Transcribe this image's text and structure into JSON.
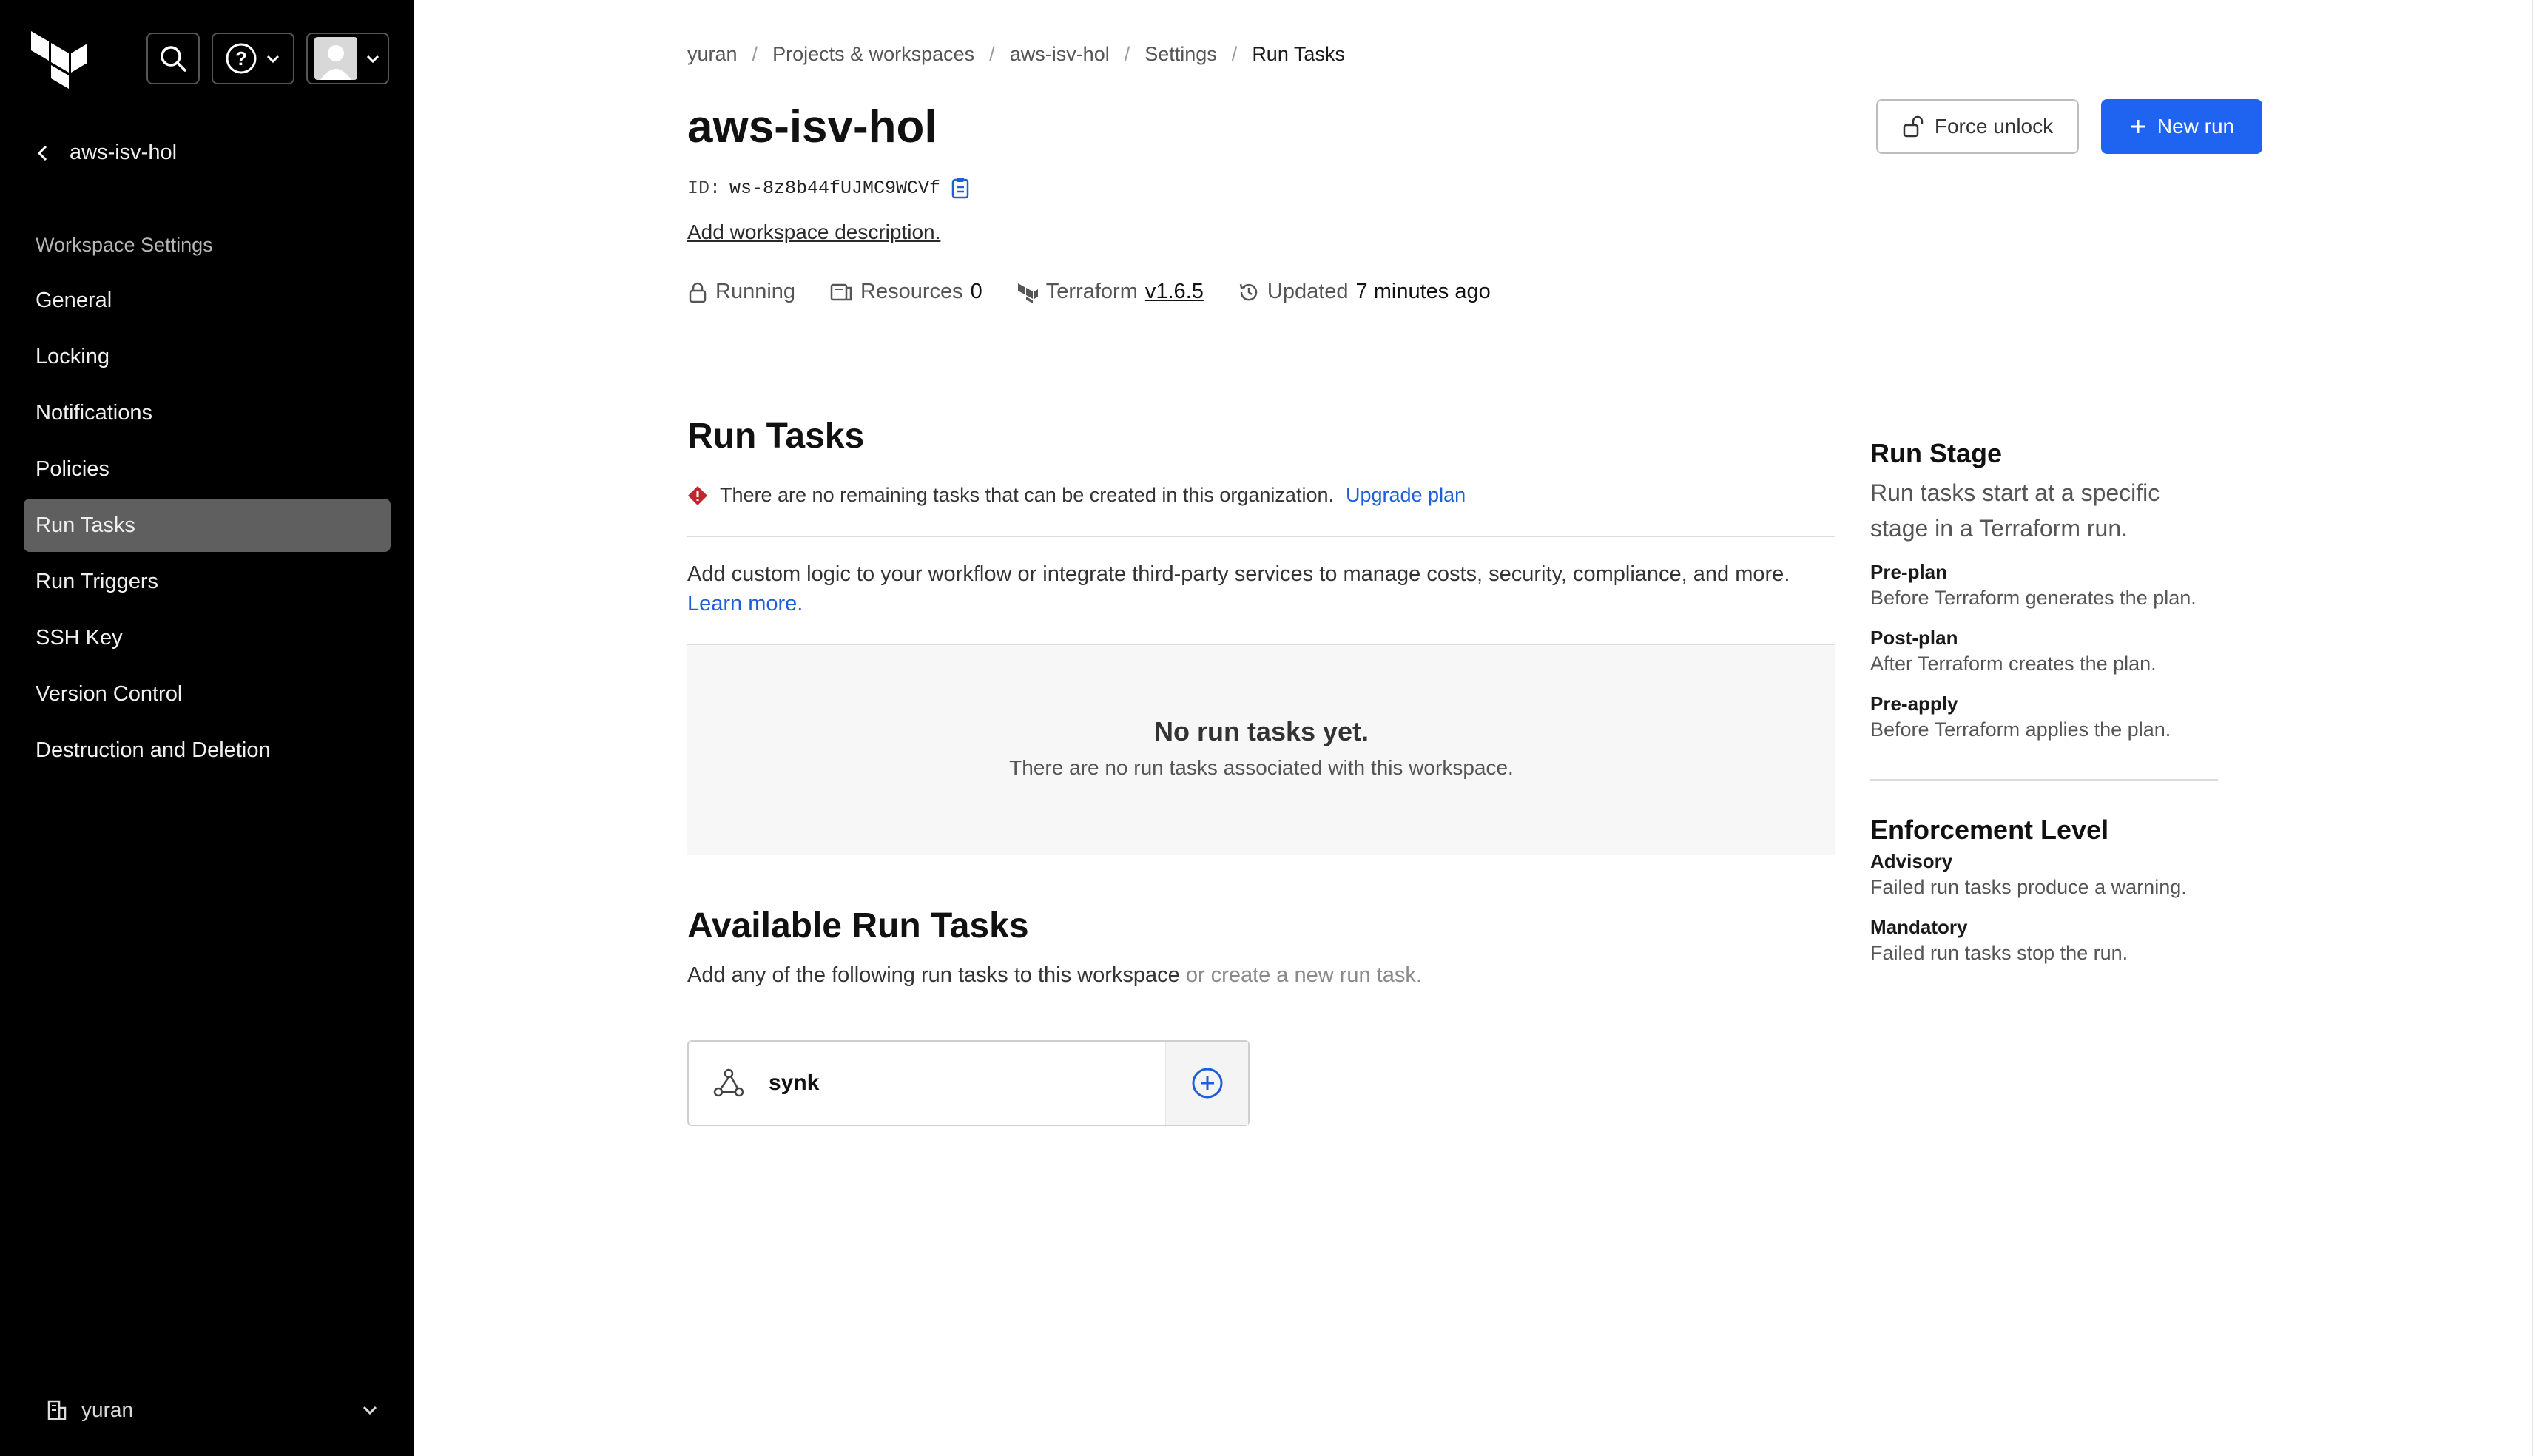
{
  "sidebar": {
    "back_label": "aws-isv-hol",
    "section_label": "Workspace Settings",
    "items": [
      {
        "label": "General"
      },
      {
        "label": "Locking"
      },
      {
        "label": "Notifications"
      },
      {
        "label": "Policies"
      },
      {
        "label": "Run Tasks",
        "active": true
      },
      {
        "label": "Run Triggers"
      },
      {
        "label": "SSH Key"
      },
      {
        "label": "Version Control"
      },
      {
        "label": "Destruction and Deletion"
      }
    ],
    "org_name": "yuran"
  },
  "breadcrumb": [
    "yuran",
    "Projects & workspaces",
    "aws-isv-hol",
    "Settings",
    "Run Tasks"
  ],
  "workspace": {
    "title": "aws-isv-hol",
    "id_label": "ID:",
    "id_value": "ws-8z8b44fUJMC9WCVf",
    "add_description": "Add workspace description.",
    "status": "Running",
    "resources_label": "Resources",
    "resources_count": "0",
    "terraform_label": "Terraform",
    "terraform_version": "v1.6.5",
    "updated_label": "Updated",
    "updated_value": "7 minutes ago"
  },
  "actions": {
    "force_unlock": "Force unlock",
    "new_run": "New run"
  },
  "run_tasks": {
    "heading": "Run Tasks",
    "warning_text": "There are no remaining tasks that can be created in this organization.",
    "upgrade_link": "Upgrade plan",
    "intro_text": "Add custom logic to your workflow or integrate third-party services to manage costs, security, compliance, and more.",
    "learn_more": "Learn more.",
    "empty_title": "No run tasks yet.",
    "empty_sub": "There are no run tasks associated with this workspace."
  },
  "available": {
    "heading": "Available Run Tasks",
    "desc": "Add any of the following run tasks to this workspace",
    "create_link": "or create a new run task.",
    "tasks": [
      {
        "name": "synk"
      }
    ]
  },
  "side_panel": {
    "run_stage_title": "Run Stage",
    "run_stage_lead": "Run tasks start at a specific stage in a Terraform run.",
    "stages": [
      {
        "term": "Pre-plan",
        "def": "Before Terraform generates the plan."
      },
      {
        "term": "Post-plan",
        "def": "After Terraform creates the plan."
      },
      {
        "term": "Pre-apply",
        "def": "Before Terraform applies the plan."
      }
    ],
    "enforcement_title": "Enforcement Level",
    "levels": [
      {
        "term": "Advisory",
        "def": "Failed run tasks produce a warning."
      },
      {
        "term": "Mandatory",
        "def": "Failed run tasks stop the run."
      }
    ]
  },
  "colors": {
    "primary": "#1e64f0",
    "link": "#1e5fd8",
    "sidebar_bg": "#000000",
    "sidebar_active": "#5f5f5f",
    "warning": "#c0262d"
  },
  "icons": [
    "terraform-logo",
    "search-icon",
    "help-icon",
    "avatar",
    "chevron-left-icon",
    "lock-icon",
    "resources-icon",
    "terraform-icon",
    "history-icon",
    "unlock-icon",
    "plus-icon",
    "warning-icon",
    "webhook-icon",
    "plus-circle-icon",
    "building-icon",
    "chevron-down-icon",
    "copy-icon"
  ]
}
